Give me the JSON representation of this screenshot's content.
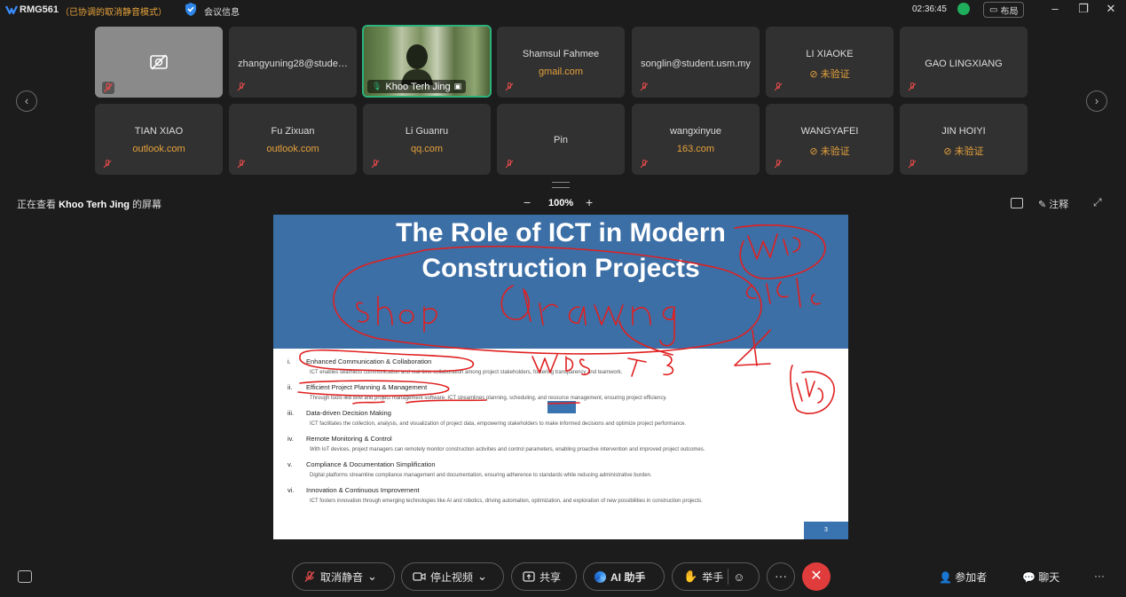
{
  "topbar": {
    "room_id": "RMG561",
    "mute_mode": "（已协调的取消静音模式）",
    "meeting_info": "会议信息",
    "clock": "02:36:45",
    "layout_label": "布局"
  },
  "participants_row1": [
    {
      "name": "",
      "sub": ""
    },
    {
      "name": "zhangyuning28@stude…",
      "sub": ""
    },
    {
      "name": "Khoo Terh Jing",
      "sub": ""
    },
    {
      "name": "Shamsul Fahmee",
      "sub": "gmail.com"
    },
    {
      "name": "songlin@student.usm.my",
      "sub": ""
    },
    {
      "name": "LI XIAOKE",
      "sub": "⊘ 未验证"
    },
    {
      "name": "GAO LINGXIANG",
      "sub": ""
    }
  ],
  "participants_row2": [
    {
      "name": "TIAN XIAO",
      "sub": "outlook.com"
    },
    {
      "name": "Fu Zixuan",
      "sub": "outlook.com"
    },
    {
      "name": "Li Guanru",
      "sub": "qq.com"
    },
    {
      "name": "Pin",
      "sub": ""
    },
    {
      "name": "wangxinyue",
      "sub": "163.com"
    },
    {
      "name": "WANGYAFEI",
      "sub": "⊘ 未验证"
    },
    {
      "name": "JIN HOIYI",
      "sub": "⊘ 未验证"
    }
  ],
  "share_bar": {
    "viewing_prefix": "正在查看",
    "viewing_name": "Khoo Terh Jing",
    "viewing_suffix": "的屏幕",
    "zoom_level": "100%",
    "annotate_label": "注释"
  },
  "slide": {
    "title_line1": "The Role of ICT in Modern",
    "title_line2": "Construction Projects",
    "page_number": "3",
    "items": [
      {
        "num": "i.",
        "title": "Enhanced Communication & Collaboration",
        "desc": "ICT enables seamless communication and real time collaboration among project stakeholders, fostering transparency and teamwork."
      },
      {
        "num": "ii.",
        "title": "Efficient Project Planning & Management",
        "desc": "Through tools like BIM and project management software, ICT streamlines planning, scheduling, and resource management, ensuring project efficiency."
      },
      {
        "num": "iii.",
        "title": "Data-driven Decision Making",
        "desc": "ICT facilitates the collection, analysis, and visualization of project data, empowering stakeholders to make informed decisions and optimize project performance."
      },
      {
        "num": "iv.",
        "title": "Remote Monitoring & Control",
        "desc": "With IoT devices, project managers can remotely monitor construction activities and control parameters, enabling proactive intervention and improved project outcomes."
      },
      {
        "num": "v.",
        "title": "Compliance & Documentation Simplification",
        "desc": "Digital platforms streamline compliance management and documentation, ensuring adherence to standards while reducing administrative burden."
      },
      {
        "num": "vi.",
        "title": "Innovation & Continuous Improvement",
        "desc": "ICT fosters innovation through emerging technologies like AI and robotics, driving automation, optimization, and exploration of new possibilities in construction projects."
      }
    ]
  },
  "bottombar": {
    "unmute_label": "取消静音",
    "stop_video_label": "停止视频",
    "share_label": "共享",
    "ai_label": "AI 助手",
    "raise_hand_label": "举手",
    "more_label": "···",
    "end_label": "✕",
    "participants_label": "参加者",
    "chat_label": "聊天",
    "overflow_label": "···"
  },
  "colors": {
    "accent_orange": "#e6a23c",
    "active_border": "#2db37c",
    "end_red": "#e03c3c",
    "slide_blue": "#3c6fa6",
    "ink_red": "#e02020"
  }
}
